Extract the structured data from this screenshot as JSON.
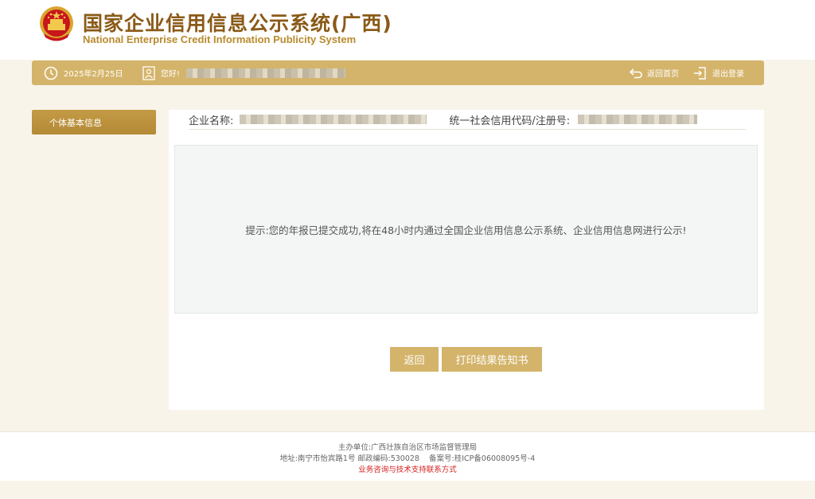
{
  "header": {
    "title": "国家企业信用信息公示系统(广西)",
    "subtitle": "National Enterprise Credit Information Publicity System",
    "emblem_icon": "national-emblem-icon"
  },
  "topbar": {
    "date": "2025年2月25日",
    "greeting": "您好!",
    "home_label": "返回首页",
    "logout_label": "退出登录"
  },
  "sidebar": {
    "items": [
      {
        "label": "个体基本信息"
      }
    ]
  },
  "main": {
    "company_name_label": "企业名称:",
    "credit_code_label": "统一社会信用代码/注册号:",
    "notice": "提示:您的年报已提交成功,将在48小时内通过全国企业信用信息公示系统、企业信用信息网进行公示!",
    "back_button": "返回",
    "print_button": "打印结果告知书"
  },
  "footer": {
    "sponsor": "主办单位:广西壮族自治区市场监督管理局",
    "address": "地址:南宁市怡宾路1号 邮政编码:530028    备案号:桂ICP备06008095号-4",
    "contact_link": "业务咨询与技术支持联系方式"
  },
  "colors": {
    "accent": "#d4b46a",
    "sidebar_active": "#b58a36",
    "title": "#8a5a18",
    "footer_link": "#d42020"
  }
}
